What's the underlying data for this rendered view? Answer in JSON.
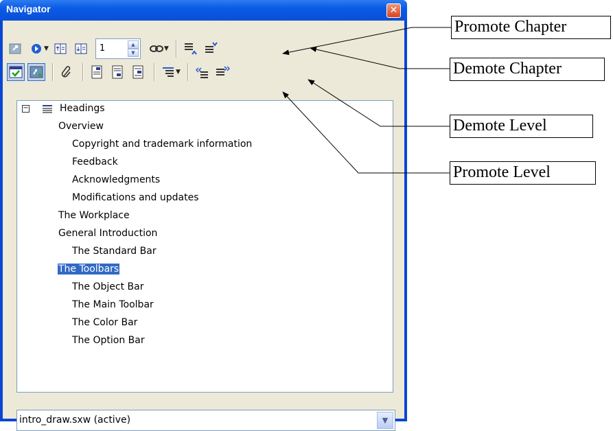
{
  "window": {
    "title": "Navigator"
  },
  "toolbar1": {
    "spin_value": "1"
  },
  "tree": {
    "root": "Headings",
    "items": [
      "Overview",
      "Copyright and trademark information",
      "Feedback",
      "Acknowledgments",
      "Modifications and updates",
      "The Workplace",
      "General Introduction",
      "The Standard Bar",
      "The Toolbars",
      "The Object Bar",
      "The Main Toolbar",
      "The Color Bar",
      "The Option Bar"
    ],
    "selected": "The Toolbars"
  },
  "document_combo": {
    "value": "intro_draw.sxw (active)"
  },
  "callouts": {
    "promote_chapter": "Promote Chapter",
    "demote_chapter": "Demote Chapter",
    "demote_level": "Demote Level",
    "promote_level": "Promote Level"
  },
  "colors": {
    "titlebar": "#0a5be6",
    "selection": "#316ac5",
    "face": "#ece9d8"
  }
}
